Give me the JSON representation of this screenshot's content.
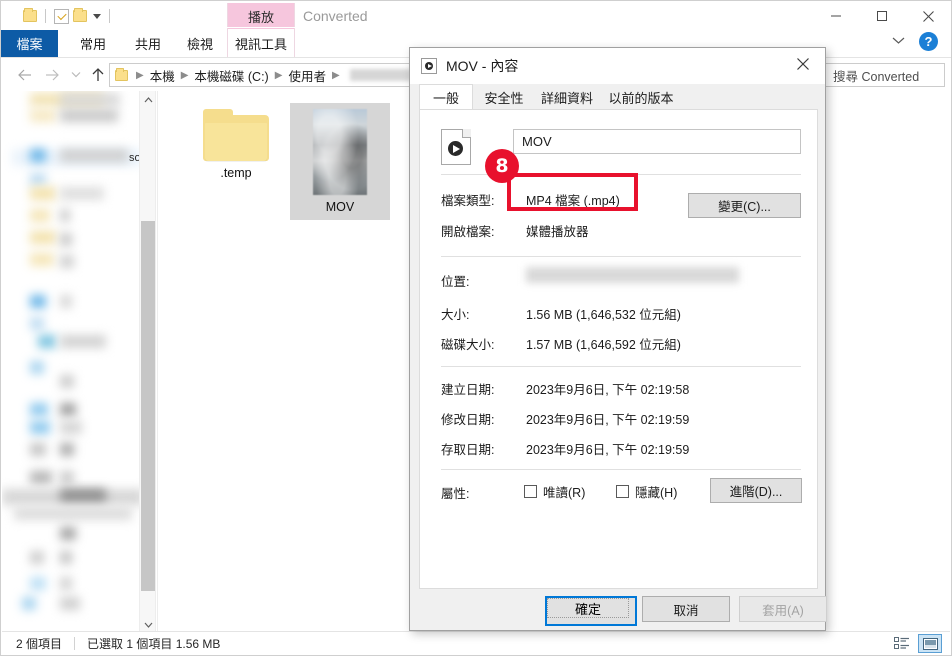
{
  "window": {
    "document_title": "Converted",
    "contextual_tab": "播放",
    "minimize_icon": "minimize-icon",
    "maximize_icon": "maximize-icon",
    "close_icon": "close-icon",
    "help_label": "?"
  },
  "quick_access": {
    "items": [
      {
        "name": "folder-icon",
        "label": ""
      },
      {
        "name": "properties-check-icon",
        "label": ""
      },
      {
        "name": "new-folder-icon",
        "label": ""
      },
      {
        "name": "customize-caret-icon",
        "label": ""
      }
    ]
  },
  "ribbon": {
    "tabs": [
      {
        "label": "檔案",
        "name": "tab-file",
        "active": false
      },
      {
        "label": "常用",
        "name": "tab-home",
        "active": false
      },
      {
        "label": "共用",
        "name": "tab-share",
        "active": false
      },
      {
        "label": "檢視",
        "name": "tab-view",
        "active": false
      },
      {
        "label": "視訊工具",
        "name": "tab-video-tools",
        "active": true
      }
    ],
    "collapse_icon": "chevron-down-icon"
  },
  "address_bar": {
    "back_icon": "back-arrow-icon",
    "forward_icon": "forward-arrow-icon",
    "recent_icon": "chevron-down-icon",
    "up_icon": "up-arrow-icon",
    "breadcrumbs": [
      {
        "label": "本機"
      },
      {
        "label": "本機磁碟 (C:)"
      },
      {
        "label": "使用者"
      },
      {
        "label": "",
        "redacted": true
      },
      {
        "label": "",
        "redacted": true
      }
    ],
    "search_placeholder": "搜尋 Converted"
  },
  "file_pane": {
    "items": [
      {
        "name": "folder-item-temp",
        "label": ".temp",
        "type": "folder",
        "selected": false
      },
      {
        "name": "file-item-mov",
        "label": "MOV",
        "type": "video",
        "selected": true
      }
    ]
  },
  "status_bar": {
    "item_count": "2 個項目",
    "selection": "已選取 1 個項目  1.56 MB",
    "views": [
      {
        "name": "details-view-button",
        "active": false
      },
      {
        "name": "large-icons-view-button",
        "active": true
      }
    ]
  },
  "dialog": {
    "title": "MOV - 內容",
    "icon": "video-file-icon",
    "close_icon": "close-icon",
    "tabs": [
      {
        "label": "一般",
        "name": "dialog-tab-general",
        "active": true
      },
      {
        "label": "安全性",
        "name": "dialog-tab-security",
        "active": false
      },
      {
        "label": "詳細資料",
        "name": "dialog-tab-details",
        "active": false
      },
      {
        "label": "以前的版本",
        "name": "dialog-tab-previous-versions",
        "active": false
      }
    ],
    "filename_value": "MOV",
    "rows": [
      {
        "label": "檔案類型:",
        "value": "MP4 檔案 (.mp4)",
        "name": "file-type-row"
      },
      {
        "label": "開啟檔案:",
        "value": "媒體播放器",
        "name": "opens-with-row"
      },
      {
        "label": "位置:",
        "value": "",
        "redacted": true,
        "name": "location-row"
      },
      {
        "label": "大小:",
        "value": "1.56 MB (1,646,532 位元組)",
        "name": "size-row"
      },
      {
        "label": "磁碟大小:",
        "value": "1.57 MB (1,646,592 位元組)",
        "name": "size-on-disk-row"
      },
      {
        "label": "建立日期:",
        "value": "2023年9月6日, 下午 02:19:58",
        "name": "created-row"
      },
      {
        "label": "修改日期:",
        "value": "2023年9月6日, 下午 02:19:59",
        "name": "modified-row"
      },
      {
        "label": "存取日期:",
        "value": "2023年9月6日, 下午 02:19:59",
        "name": "accessed-row"
      }
    ],
    "change_button": "變更(C)...",
    "attributes_label": "屬性:",
    "readonly_label": "唯讀(R)",
    "hidden_label": "隱藏(H)",
    "advanced_button": "進階(D)...",
    "ok_button": "確定",
    "cancel_button": "取消",
    "apply_button": "套用(A)"
  },
  "annotation": {
    "badge_number": "8",
    "accent_color": "#e8112d"
  }
}
